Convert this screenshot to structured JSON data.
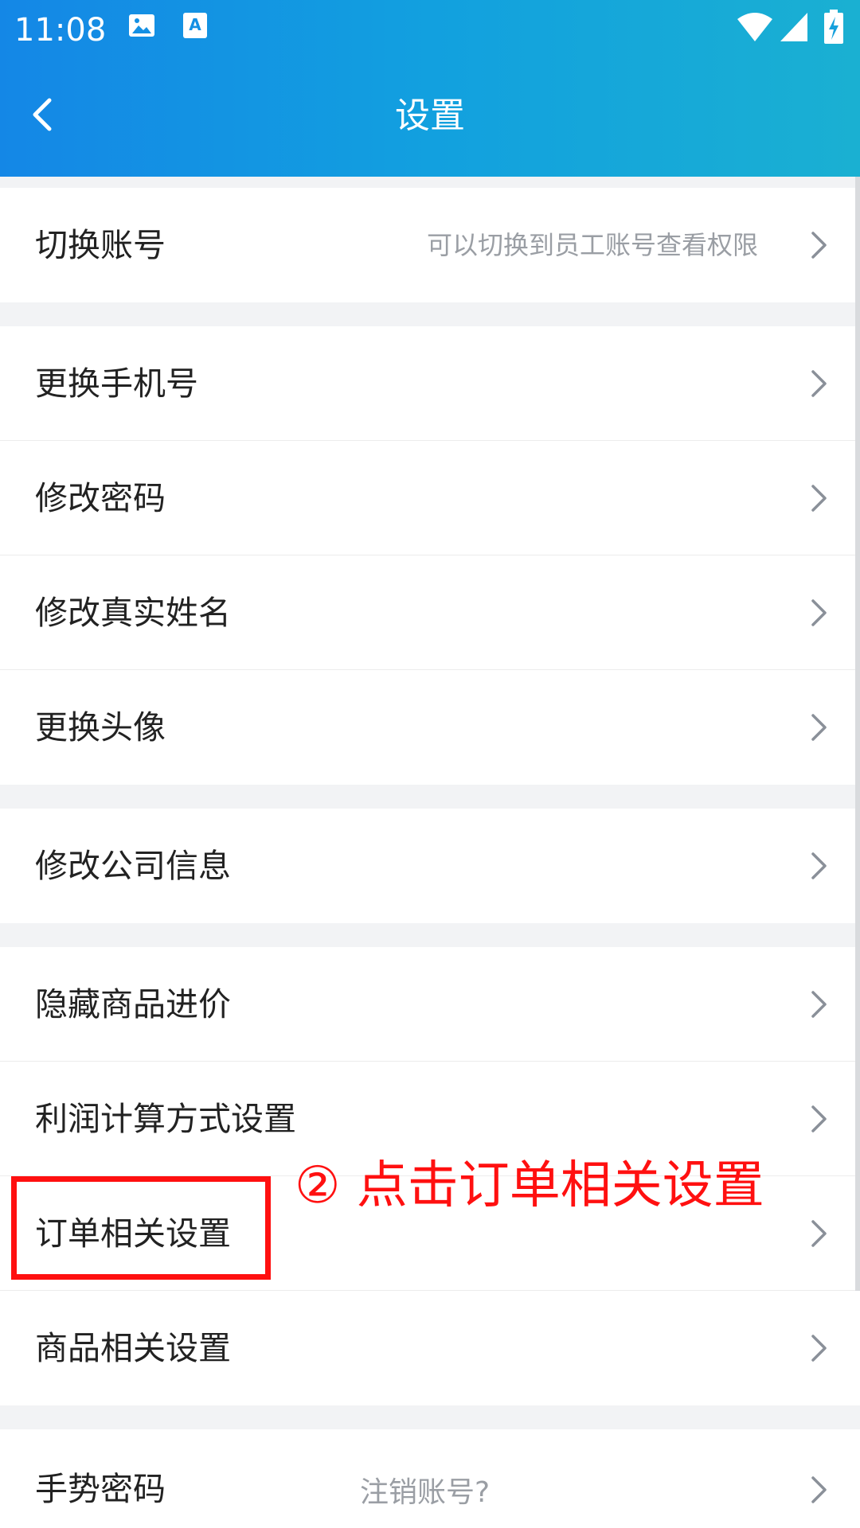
{
  "status_bar": {
    "time": "11:08",
    "icons": [
      "image-icon",
      "font-a-icon",
      "wifi-icon",
      "signal-icon",
      "battery-charging-icon"
    ]
  },
  "header": {
    "title": "设置",
    "back_icon": "chevron-left-icon"
  },
  "groups": [
    {
      "items": [
        {
          "label": "切换账号",
          "hint": "可以切换到员工账号查看权限"
        }
      ]
    },
    {
      "items": [
        {
          "label": "更换手机号"
        },
        {
          "label": "修改密码"
        },
        {
          "label": "修改真实姓名"
        },
        {
          "label": "更换头像"
        }
      ]
    },
    {
      "items": [
        {
          "label": "修改公司信息"
        }
      ]
    },
    {
      "items": [
        {
          "label": "隐藏商品进价"
        },
        {
          "label": "利润计算方式设置"
        },
        {
          "label": "订单相关设置"
        },
        {
          "label": "商品相关设置"
        }
      ]
    },
    {
      "items": [
        {
          "label": "手势密码",
          "hint": "注销账号?"
        }
      ]
    }
  ],
  "annotation": {
    "text": "② 点击订单相关设置",
    "color": "#ff1010"
  },
  "colors": {
    "header_start": "#1487e6",
    "header_end": "#1ab0d2",
    "background": "#f2f3f5"
  }
}
